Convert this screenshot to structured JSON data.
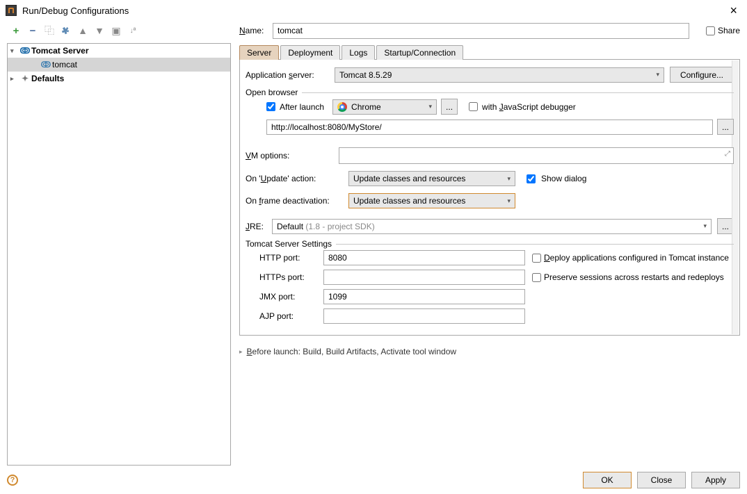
{
  "window": {
    "title": "Run/Debug Configurations"
  },
  "tree": {
    "node1_label": "Tomcat Server",
    "node1_child": "tomcat",
    "node2_label": "Defaults"
  },
  "name": {
    "label": "Name:",
    "value": "tomcat",
    "share_label": "Share"
  },
  "tabs": {
    "server": "Server",
    "deployment": "Deployment",
    "logs": "Logs",
    "startup": "Startup/Connection"
  },
  "appserver": {
    "label": "Application server:",
    "value": "Tomcat 8.5.29",
    "configure": "Configure..."
  },
  "openbrowser": {
    "group_title": "Open browser",
    "after_launch": "After launch",
    "browser": "Chrome",
    "ellipsis": "...",
    "js_debugger": "with JavaScript debugger",
    "url": "http://localhost:8080/MyStore/"
  },
  "vm": {
    "label": "VM options:"
  },
  "update": {
    "on_update_label": "On 'Update' action:",
    "on_frame_label": "On frame deactivation:",
    "value": "Update classes and resources",
    "show_dialog": "Show dialog"
  },
  "jre": {
    "label": "JRE:",
    "prefix": "Default ",
    "suffix": "(1.8 - project SDK)"
  },
  "tomcat_settings": {
    "group_title": "Tomcat Server Settings",
    "http_label": "HTTP port:",
    "http_value": "8080",
    "https_label": "HTTPs port:",
    "https_value": "",
    "jmx_label": "JMX port:",
    "jmx_value": "1099",
    "ajp_label": "AJP port:",
    "ajp_value": "",
    "deploy_chk": "Deploy applications configured in Tomcat instance",
    "preserve_chk": "Preserve sessions across restarts and redeploys"
  },
  "before_launch": "Before launch: Build, Build Artifacts, Activate tool window",
  "buttons": {
    "ok": "OK",
    "close": "Close",
    "apply": "Apply"
  }
}
